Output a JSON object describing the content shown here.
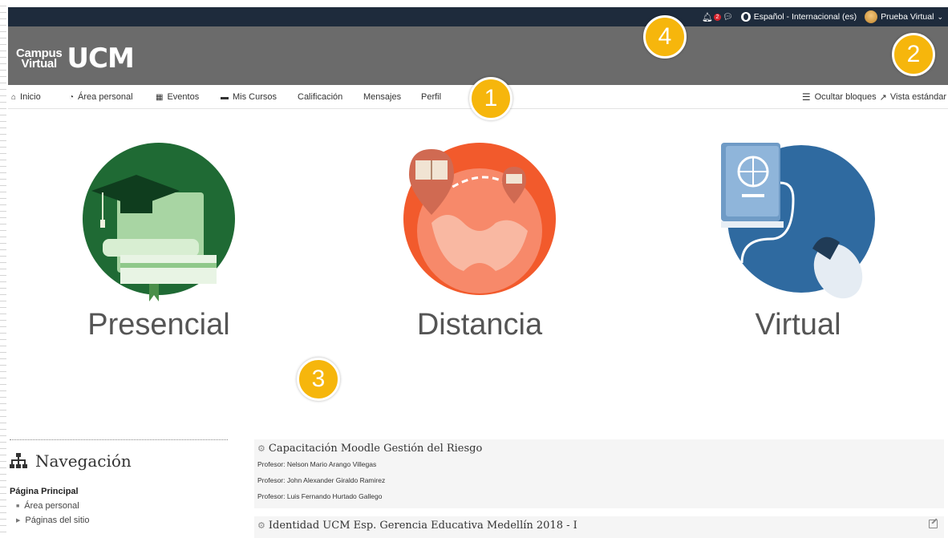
{
  "topbar": {
    "notif_count": "2",
    "language": "Español - Internacional (es)",
    "user_name": "Prueba Virtual"
  },
  "header": {
    "logo_word_1": "Campus",
    "logo_word_2": "Virtual",
    "logo_brand": "UCM"
  },
  "markers": [
    "1",
    "2",
    "3",
    "4"
  ],
  "nav": {
    "items": [
      "Inicio",
      "Área personal",
      "Eventos",
      "Mis Cursos",
      "Calificación",
      "Mensajes",
      "Perfil"
    ],
    "hide_blocks": "Ocultar bloques",
    "standard_view": "Vista estándar"
  },
  "modalities": [
    "Presencial",
    "Distancia",
    "Virtual"
  ],
  "navigation_block": {
    "title": "Navegación",
    "main": "Página Principal",
    "items": [
      "Área personal",
      "Páginas del sitio"
    ]
  },
  "courses": [
    {
      "title": "Capacitación Moodle Gestión del Riesgo",
      "teachers": [
        "Profesor: Nelson Mario Arango Villegas",
        "Profesor: John Alexander Giraldo Ramirez",
        "Profesor: Luis Fernando Hurtado Gallego"
      ]
    },
    {
      "title": "Identidad UCM Esp. Gerencia Educativa Medellín 2018 - I",
      "teachers": []
    }
  ],
  "colors": {
    "topbar": "#1e2b3c",
    "header": "#6b6b6b",
    "marker": "#f6b60c",
    "presencial": "#1f6a34",
    "distancia": "#f25a2c",
    "virtual": "#2f6aa0"
  }
}
